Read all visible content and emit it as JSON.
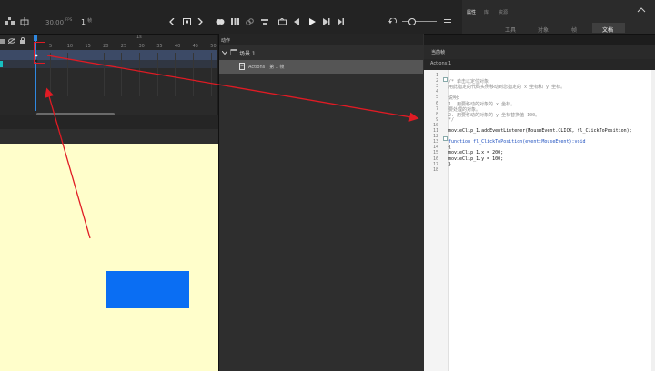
{
  "toolbar": {
    "fps": "30.00",
    "fps_unit": "FPS",
    "frame": "1",
    "frame_unit": "帧"
  },
  "right_tabs": {
    "properties": "属性",
    "library": "库",
    "assets": "资源",
    "tools": "工具",
    "object": "对象",
    "frame": "帧",
    "document": "文档"
  },
  "timeline": {
    "marker": "1s",
    "ruler_ticks": [
      "5",
      "10",
      "15",
      "20",
      "25",
      "30",
      "35",
      "40",
      "45",
      "50"
    ]
  },
  "actions_panel": {
    "title": "动作",
    "scene": "场景 1",
    "actions_item": "Actions : 第 1 帧"
  },
  "code_panel": {
    "title": "当前帧",
    "subtitle": "Actions:1",
    "line_numbers": [
      "1",
      "2",
      "3",
      "4",
      "5",
      "6",
      "7",
      "8",
      "9",
      "10",
      "11",
      "12",
      "13",
      "14",
      "15",
      "16",
      "17",
      "18"
    ],
    "lines": [
      "",
      "/* 单击以定位对象",
      "用此指定的代码实例移动到您指定的 x 坐标和 y 坐标。",
      "",
      "说明:",
      "1. 用要移动的对象的 x 坐标。",
      "要处理的对象。",
      "2. 用要移动的对象的 y 坐标替换值 100。",
      "*/",
      "",
      "movieClip_1.addEventListener(MouseEvent.CLICK, fl_ClickToPosition);",
      "",
      "function fl_ClickToPosition(event:MouseEvent):void",
      "{",
      "    movieClip_1.x = 200;",
      "    movieClip_1.y = 100;",
      "}",
      ""
    ]
  },
  "colors": {
    "stage": "#fffecb",
    "movieclip": "#0a6ef3",
    "annotation": "#e01b24"
  }
}
